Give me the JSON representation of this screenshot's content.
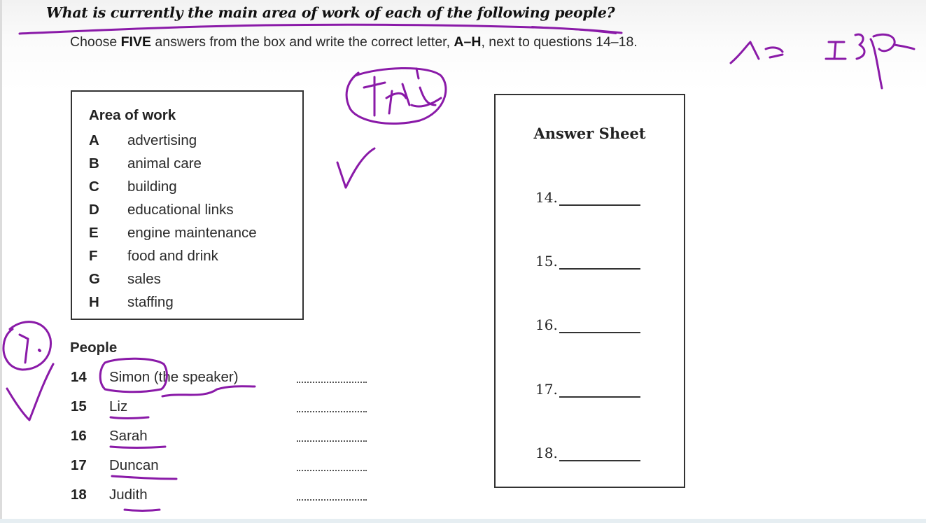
{
  "question": {
    "heading": "What is currently the main area of work of each of the following people?",
    "instruction_prefix": "Choose ",
    "instruction_count": "FIVE",
    "instruction_middle": " answers from the box and write the correct letter, ",
    "instruction_range": "A–H",
    "instruction_suffix": ", next to questions 14–18."
  },
  "area_box": {
    "title": "Area of work",
    "items": [
      {
        "letter": "A",
        "label": "advertising"
      },
      {
        "letter": "B",
        "label": "animal care"
      },
      {
        "letter": "C",
        "label": "building"
      },
      {
        "letter": "D",
        "label": "educational links"
      },
      {
        "letter": "E",
        "label": "engine maintenance"
      },
      {
        "letter": "F",
        "label": "food and drink"
      },
      {
        "letter": "G",
        "label": "sales"
      },
      {
        "letter": "H",
        "label": "staffing"
      }
    ]
  },
  "people": {
    "title": "People",
    "items": [
      {
        "number": "14",
        "name": "Simon (the speaker)"
      },
      {
        "number": "15",
        "name": "Liz"
      },
      {
        "number": "16",
        "name": "Sarah"
      },
      {
        "number": "17",
        "name": "Duncan"
      },
      {
        "number": "18",
        "name": "Judith"
      }
    ]
  },
  "answer_sheet": {
    "title": "Answer Sheet",
    "lines": [
      "14.",
      "15.",
      "16.",
      "17.",
      "18."
    ]
  },
  "colors": {
    "annotation_ink": "#8a1aa8",
    "text": "#1a1a1a",
    "border": "#333333"
  }
}
